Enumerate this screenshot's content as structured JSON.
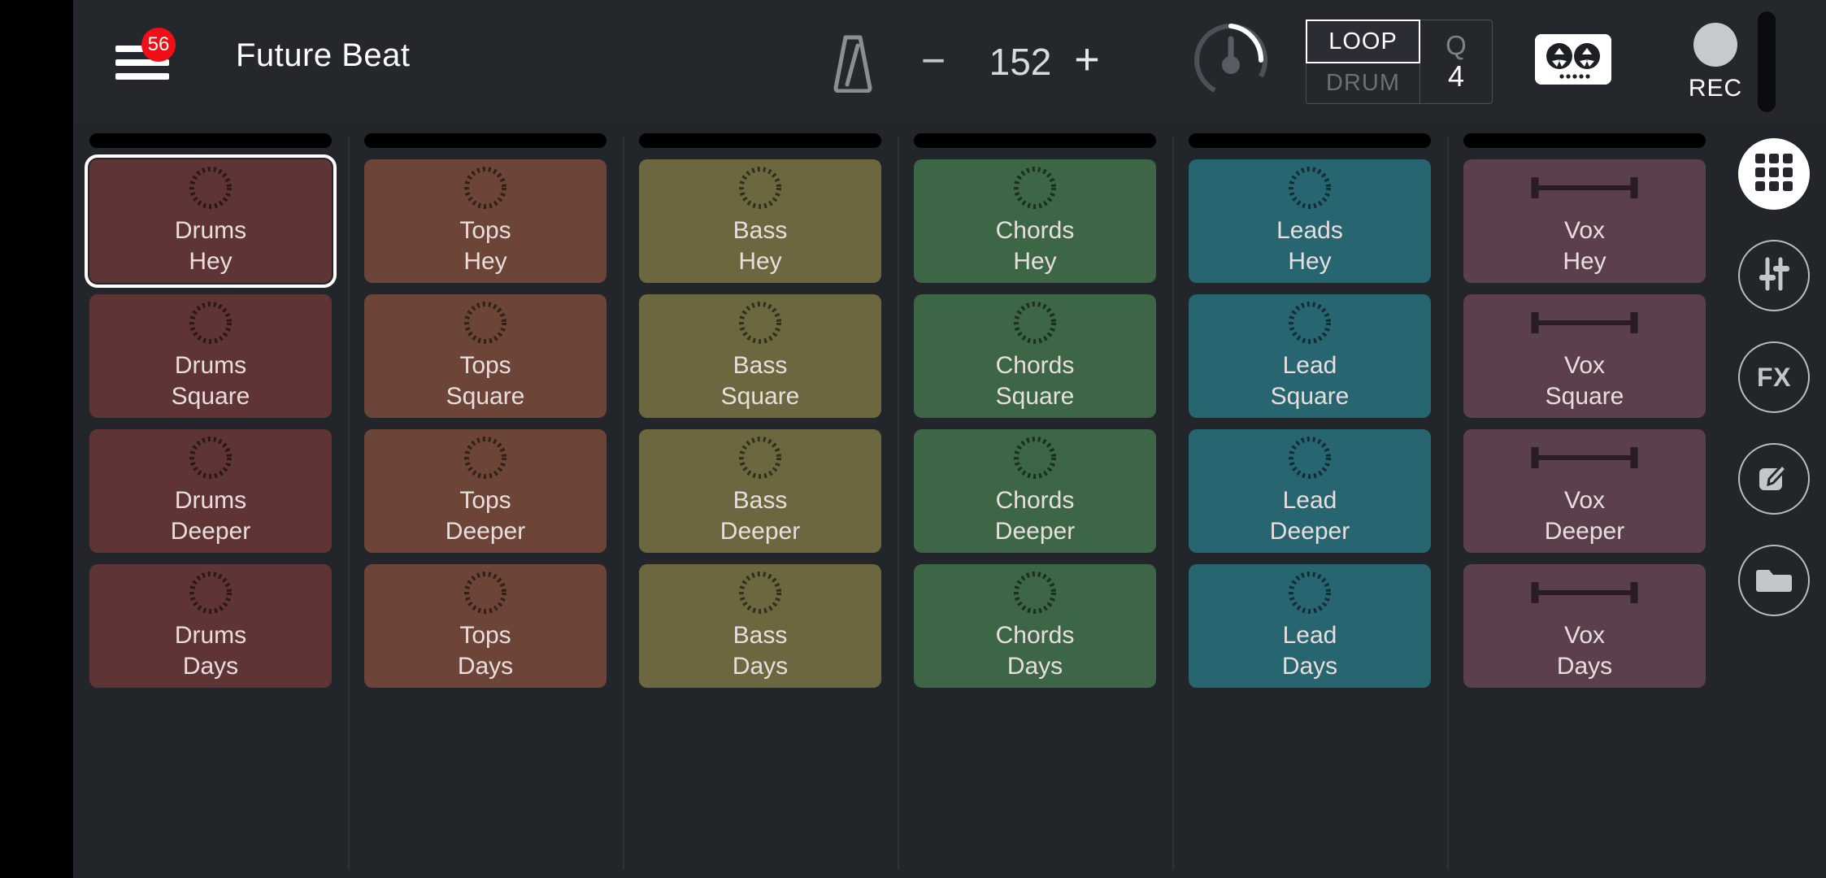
{
  "app": {
    "project_title": "Future Beat",
    "menu_badge": "56",
    "menu_icon": "hamburger-menu-icon"
  },
  "transport": {
    "metronome_icon": "metronome-icon",
    "tempo_minus_label": "−",
    "tempo_value": "152",
    "tempo_plus_label": "+",
    "knob_icon": "knob-dial-icon",
    "loop_label": "LOOP",
    "drum_label": "DRUM",
    "quantize_label": "Q",
    "quantize_value": "4",
    "tape_icon": "tape-recorder-icon",
    "rec_label": "REC",
    "rec_icon": "record-dot-icon"
  },
  "colors": {
    "background": "#22262b",
    "topbar": "#24282d",
    "accent_badge": "#f10f17",
    "selection": "#ffffff",
    "drums": "#5e3434",
    "tops": "#6c4438",
    "bass": "#6d6740",
    "chords": "#3c6646",
    "leads": "#276570",
    "vox": "#5c3f4c"
  },
  "grid": {
    "columns": [
      {
        "name": "drums",
        "color": "#5e3434",
        "cells": [
          {
            "line1": "Drums",
            "line2": "Hey",
            "icon": "loop-circle-icon",
            "selected": true
          },
          {
            "line1": "Drums",
            "line2": "Square",
            "icon": "loop-circle-icon",
            "selected": false
          },
          {
            "line1": "Drums",
            "line2": "Deeper",
            "icon": "loop-circle-icon",
            "selected": false
          },
          {
            "line1": "Drums",
            "line2": "Days",
            "icon": "loop-circle-icon",
            "selected": false
          }
        ]
      },
      {
        "name": "tops",
        "color": "#6c4438",
        "cells": [
          {
            "line1": "Tops",
            "line2": "Hey",
            "icon": "loop-circle-icon",
            "selected": false
          },
          {
            "line1": "Tops",
            "line2": "Square",
            "icon": "loop-circle-icon",
            "selected": false
          },
          {
            "line1": "Tops",
            "line2": "Deeper",
            "icon": "loop-circle-icon",
            "selected": false
          },
          {
            "line1": "Tops",
            "line2": "Days",
            "icon": "loop-circle-icon",
            "selected": false
          }
        ]
      },
      {
        "name": "bass",
        "color": "#6d6740",
        "cells": [
          {
            "line1": "Bass",
            "line2": "Hey",
            "icon": "loop-circle-icon",
            "selected": false
          },
          {
            "line1": "Bass",
            "line2": "Square",
            "icon": "loop-circle-icon",
            "selected": false
          },
          {
            "line1": "Bass",
            "line2": "Deeper",
            "icon": "loop-circle-icon",
            "selected": false
          },
          {
            "line1": "Bass",
            "line2": "Days",
            "icon": "loop-circle-icon",
            "selected": false
          }
        ]
      },
      {
        "name": "chords",
        "color": "#3c6646",
        "cells": [
          {
            "line1": "Chords",
            "line2": "Hey",
            "icon": "loop-circle-icon",
            "selected": false
          },
          {
            "line1": "Chords",
            "line2": "Square",
            "icon": "loop-circle-icon",
            "selected": false
          },
          {
            "line1": "Chords",
            "line2": "Deeper",
            "icon": "loop-circle-icon",
            "selected": false
          },
          {
            "line1": "Chords",
            "line2": "Days",
            "icon": "loop-circle-icon",
            "selected": false
          }
        ]
      },
      {
        "name": "leads",
        "color": "#276570",
        "cells": [
          {
            "line1": "Leads",
            "line2": "Hey",
            "icon": "loop-circle-icon",
            "selected": false
          },
          {
            "line1": "Lead",
            "line2": "Square",
            "icon": "loop-circle-icon",
            "selected": false
          },
          {
            "line1": "Lead",
            "line2": "Deeper",
            "icon": "loop-circle-icon",
            "selected": false
          },
          {
            "line1": "Lead",
            "line2": "Days",
            "icon": "loop-circle-icon",
            "selected": false
          }
        ]
      },
      {
        "name": "vox",
        "color": "#5c3f4c",
        "cells": [
          {
            "line1": "Vox",
            "line2": "Hey",
            "icon": "oneshot-bar-icon",
            "selected": false
          },
          {
            "line1": "Vox",
            "line2": "Square",
            "icon": "oneshot-bar-icon",
            "selected": false
          },
          {
            "line1": "Vox",
            "line2": "Deeper",
            "icon": "oneshot-bar-icon",
            "selected": false
          },
          {
            "line1": "Vox",
            "line2": "Days",
            "icon": "oneshot-bar-icon",
            "selected": false
          }
        ]
      }
    ]
  },
  "rail": {
    "items": [
      {
        "name": "grid-view",
        "icon": "grid-nine-dots-icon",
        "label": "",
        "active": true
      },
      {
        "name": "mixer",
        "icon": "mixer-faders-icon",
        "label": "",
        "active": false
      },
      {
        "name": "fx",
        "icon": "fx-icon",
        "label": "FX",
        "active": false
      },
      {
        "name": "edit",
        "icon": "edit-pencil-icon",
        "label": "",
        "active": false
      },
      {
        "name": "browser",
        "icon": "folder-icon",
        "label": "",
        "active": false
      }
    ]
  }
}
